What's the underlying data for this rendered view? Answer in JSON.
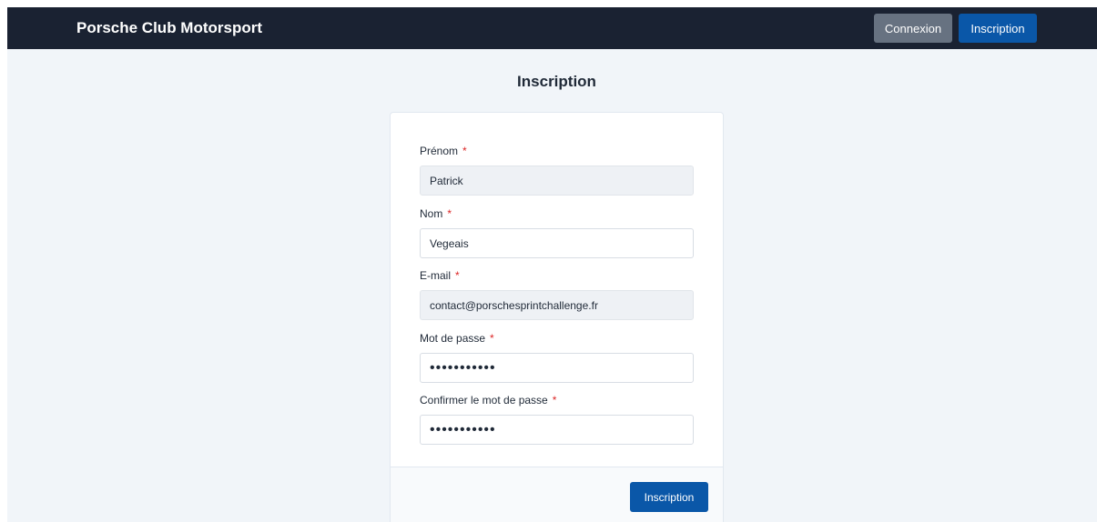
{
  "header": {
    "brand": "Porsche Club Motorsport",
    "login_label": "Connexion",
    "signup_label": "Inscription"
  },
  "page": {
    "title": "Inscription"
  },
  "form": {
    "required_marker": "*",
    "first_name": {
      "label": "Prénom",
      "value": "Patrick"
    },
    "last_name": {
      "label": "Nom",
      "value": "Vegeais"
    },
    "email": {
      "label": "E-mail",
      "value": "contact@porschesprintchallenge.fr"
    },
    "password": {
      "label": "Mot de passe",
      "value": "•••••••••••"
    },
    "confirm_password": {
      "label": "Confirmer le mot de passe",
      "value": "•••••••••••"
    },
    "submit_label": "Inscription"
  },
  "colors": {
    "navbar": "#1a2232",
    "primary": "#0a57a8",
    "secondary": "#677281",
    "required": "#dc2626"
  }
}
